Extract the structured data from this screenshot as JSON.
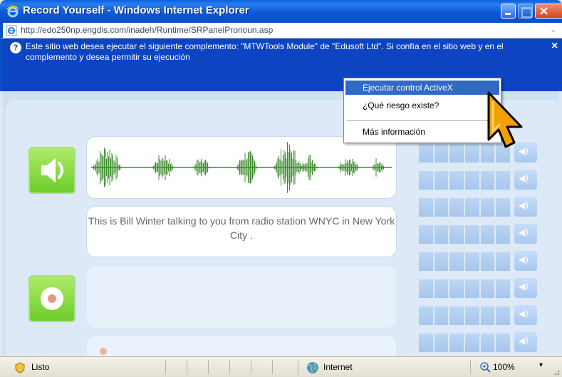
{
  "window": {
    "title": "Record Yourself - Windows Internet Explorer",
    "close_symbol": "×"
  },
  "address_bar": {
    "url": "http://edo250np.engdis.com/inadeh/Runtime/SRPanelPronoun.asp",
    "dropdown_symbol": "⌄",
    "page_icon": "ie-page-icon"
  },
  "info_bar": {
    "icon_symbol": "?",
    "message": "Este sitio web desea ejecutar el siguiente complemento: \"MTWTools Module\" de \"Edusoft Ltd\". Si confía en el sitio web y en el complemento y desea permitir su ejecución",
    "close_symbol": "×"
  },
  "context_menu": {
    "items": [
      {
        "label": "Ejecutar control ActiveX",
        "highlighted": true
      },
      {
        "label": "¿Qué riesgo existe?",
        "highlighted": false
      },
      {
        "label": "Más información",
        "highlighted": false
      }
    ]
  },
  "recorder": {
    "sentence": "This is Bill Winter talking to you from radio station WNYC in New York City .",
    "speaker_icon": "speaker-icon",
    "record_icon": "record-icon",
    "score_rows": 8
  },
  "status_bar": {
    "status": "Listo",
    "zone": "Internet",
    "zoom": "100%",
    "zoom_dropdown": "▾"
  },
  "colors": {
    "titlebar": "#0b57d9",
    "infobar": "#0d44c2",
    "menu_highlight": "#316ac5",
    "green_button": "#6ccc2a",
    "waveform": "#3b8c2c",
    "cursor_orange": "#f2a000"
  }
}
